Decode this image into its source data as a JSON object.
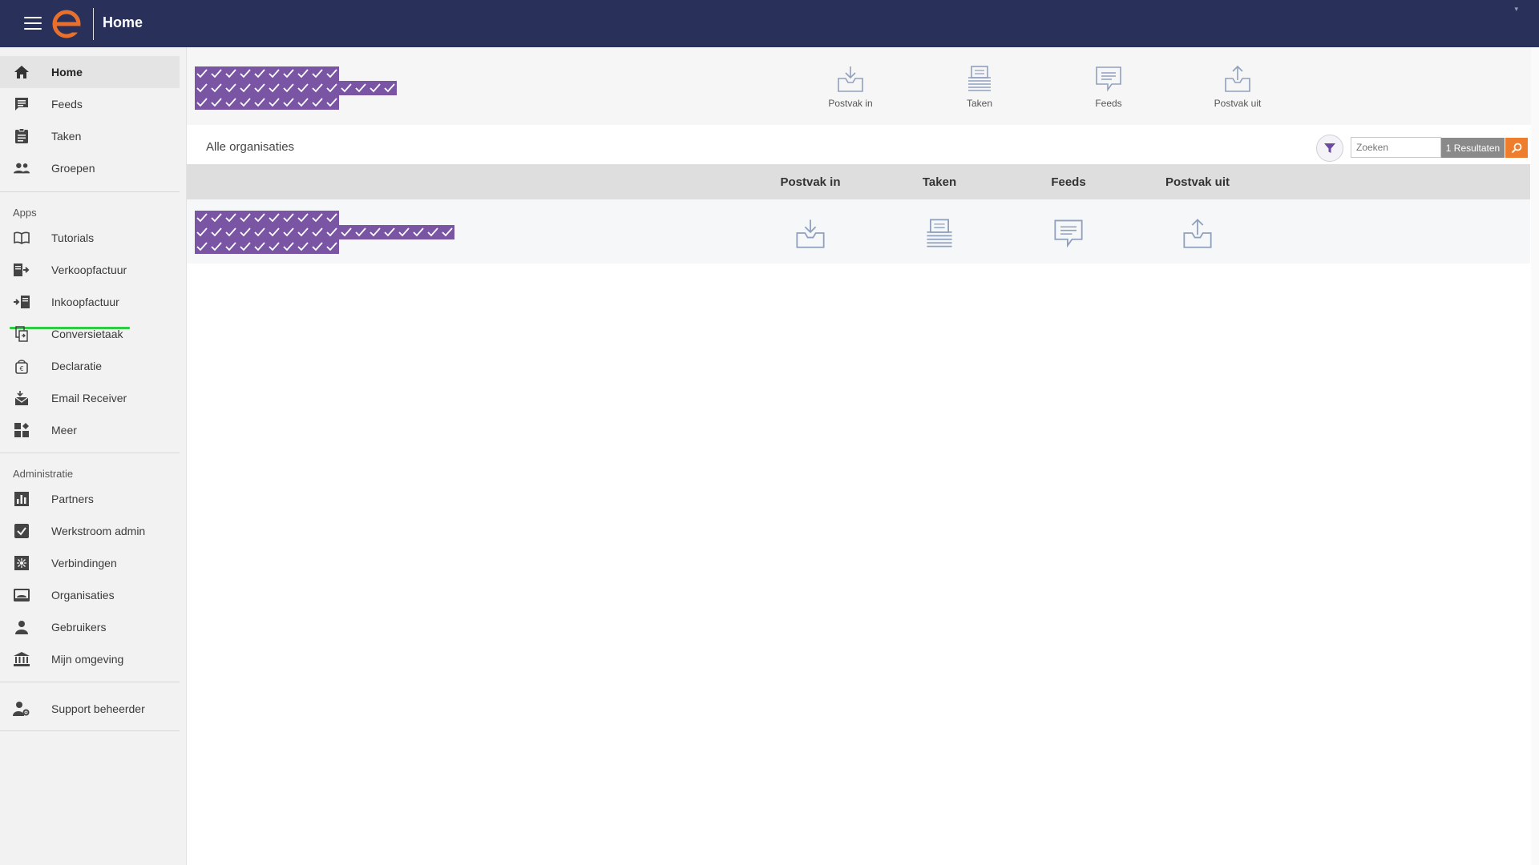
{
  "topbar": {
    "title": "Home",
    "menu_icon": "hamburger-menu-icon",
    "logo_icon": "e-logo-icon",
    "accent": "#e86f2c",
    "background": "#29315a"
  },
  "sidebar": {
    "main_items": [
      {
        "label": "Home",
        "icon": "home-icon",
        "active": true
      },
      {
        "label": "Feeds",
        "icon": "feed-icon"
      },
      {
        "label": "Taken",
        "icon": "clipboard-icon"
      },
      {
        "label": "Groepen",
        "icon": "group-icon"
      }
    ],
    "apps_label": "Apps",
    "apps_items": [
      {
        "label": "Tutorials",
        "icon": "book-icon"
      },
      {
        "label": "Verkoopfactuur",
        "icon": "invoice-out-icon"
      },
      {
        "label": "Inkoopfactuur",
        "icon": "invoice-in-icon"
      },
      {
        "label": "Conversietaak",
        "icon": "convert-icon"
      },
      {
        "label": "Declaratie",
        "icon": "declaration-icon"
      },
      {
        "label": "Email Receiver",
        "icon": "email-receiver-icon"
      },
      {
        "label": "Meer",
        "icon": "more-apps-icon"
      }
    ],
    "admin_label": "Administratie",
    "admin_items": [
      {
        "label": "Partners",
        "icon": "bar-chart-icon"
      },
      {
        "label": "Werkstroom admin",
        "icon": "checkbox-icon"
      },
      {
        "label": "Verbindingen",
        "icon": "connections-icon"
      },
      {
        "label": "Organisaties",
        "icon": "organisation-icon"
      },
      {
        "label": "Gebruikers",
        "icon": "user-icon"
      },
      {
        "label": "Mijn omgeving",
        "icon": "institution-icon"
      }
    ],
    "support_item": {
      "label": "Support beheerder",
      "icon": "support-admin-icon"
    }
  },
  "header_icons": [
    {
      "label": "Postvak in",
      "icon": "inbox-icon"
    },
    {
      "label": "Taken",
      "icon": "tasks-stack-icon"
    },
    {
      "label": "Feeds",
      "icon": "chat-bubble-icon"
    },
    {
      "label": "Postvak uit",
      "icon": "outbox-icon"
    }
  ],
  "org_bar": {
    "title": "Alle organisaties",
    "search_placeholder": "Zoeken",
    "results": "1 Resultaten",
    "filter_icon": "filter-icon",
    "search_icon": "search-icon"
  },
  "table": {
    "columns": [
      "Postvak in",
      "Taken",
      "Feeds",
      "Postvak uit"
    ],
    "rows": [
      {
        "icons": [
          "inbox-icon",
          "tasks-stack-icon",
          "chat-bubble-icon",
          "outbox-icon"
        ]
      }
    ]
  }
}
